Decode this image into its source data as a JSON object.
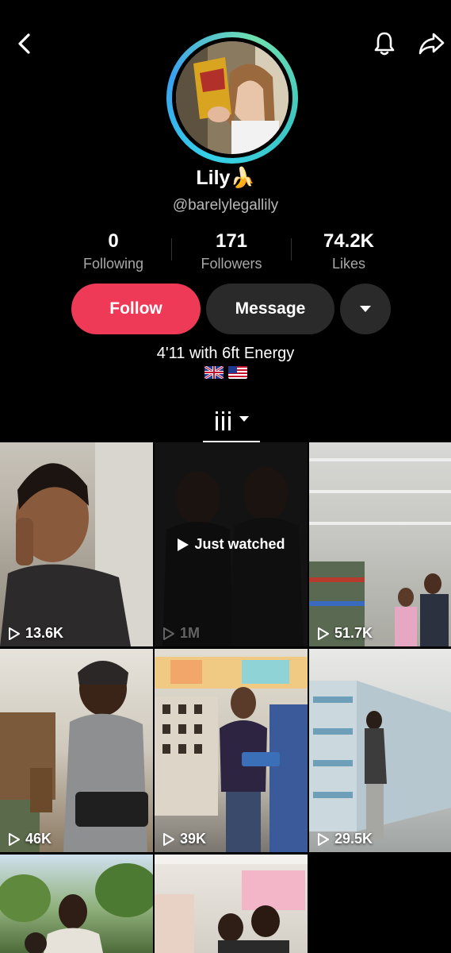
{
  "profile": {
    "name": "Lily🍌",
    "handle": "@barelylegallily",
    "bio": "4'11 with 6ft Energy",
    "flags": [
      "uk-flag",
      "us-flag"
    ]
  },
  "stats": [
    {
      "value": "0",
      "label": "Following"
    },
    {
      "value": "171",
      "label": "Followers"
    },
    {
      "value": "74.2K",
      "label": "Likes"
    }
  ],
  "actions": {
    "follow_label": "Follow",
    "message_label": "Message"
  },
  "colors": {
    "follow": "#ee3a57",
    "secondary_button": "#2a2a2a",
    "avatar_ring": "#35d0e8"
  },
  "icons": {
    "back": "chevron-left-icon",
    "notify": "bell-icon",
    "share": "share-arrow-icon",
    "more": "caret-down-icon",
    "tab": "grid-icon"
  },
  "videos": [
    {
      "views": "13.6K"
    },
    {
      "views": "1M",
      "overlay": "Just watched"
    },
    {
      "views": "51.7K"
    },
    {
      "views": "46K"
    },
    {
      "views": "39K"
    },
    {
      "views": "29.5K"
    },
    {
      "views": ""
    },
    {
      "views": ""
    }
  ]
}
